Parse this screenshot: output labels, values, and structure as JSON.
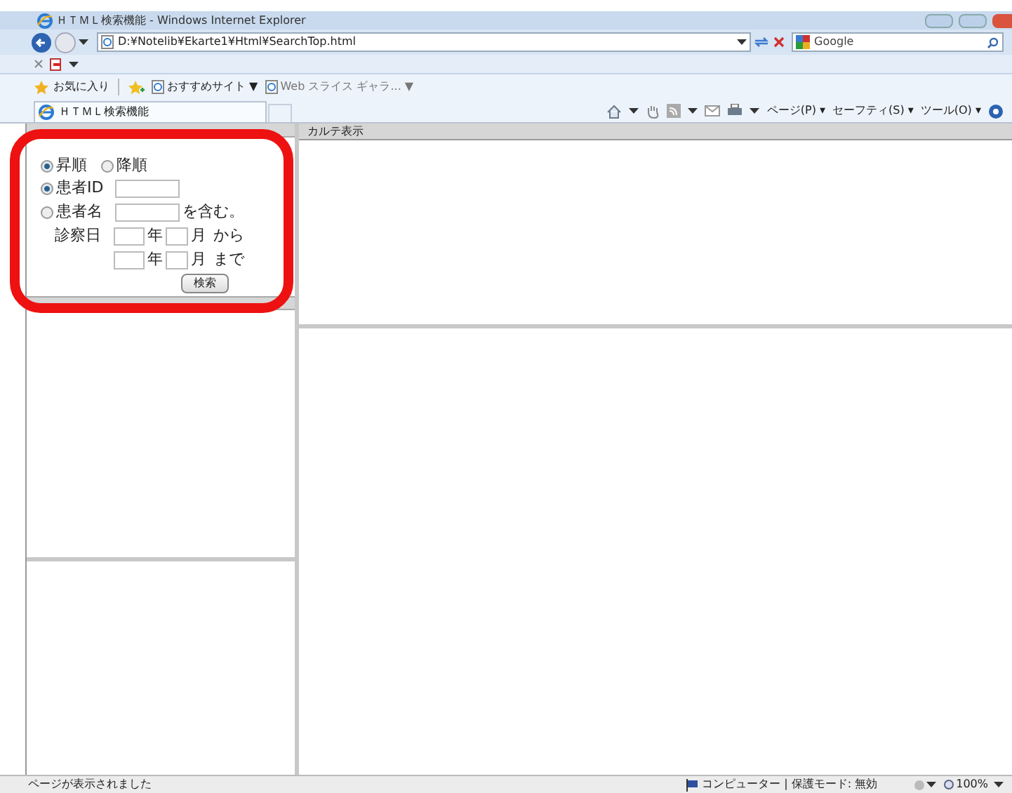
{
  "window": {
    "title": "ＨＴＭＬ検索機能 - Windows Internet Explorer"
  },
  "address_bar": {
    "url": "D:¥Notelib¥Ekarte1¥Html¥SearchTop.html",
    "search_placeholder": "Google"
  },
  "favorites_bar": {
    "favorites": "お気に入り",
    "links": [
      {
        "label": "おすすめサイト ▼"
      },
      {
        "label": "Web スライス ギャラ... ▼"
      }
    ]
  },
  "tab": {
    "title": "ＨＴＭＬ検索機能"
  },
  "command_bar": {
    "items": [
      {
        "label": "ページ(P) ▾"
      },
      {
        "label": "セーフティ(S) ▾"
      },
      {
        "label": "ツール(O) ▾"
      }
    ]
  },
  "search_form": {
    "sort_options": [
      {
        "label": "昇順",
        "selected": true
      },
      {
        "label": "降順",
        "selected": false
      }
    ],
    "criteria": [
      {
        "label": "患者ID",
        "selected": true
      },
      {
        "label": "患者名",
        "selected": false,
        "suffix": "を含む。"
      }
    ],
    "date_label": "診察日",
    "from_row": {
      "year": "年",
      "month": "月",
      "word": "から"
    },
    "to_row": {
      "year": "年",
      "month": "月",
      "word": "まで"
    },
    "button": "検索"
  },
  "chart_pane": {
    "header": "カルテ表示"
  },
  "status_bar": {
    "message": "ページが表示されました",
    "zone": "コンピューター | 保護モード: 無効",
    "zoom": "100%"
  }
}
